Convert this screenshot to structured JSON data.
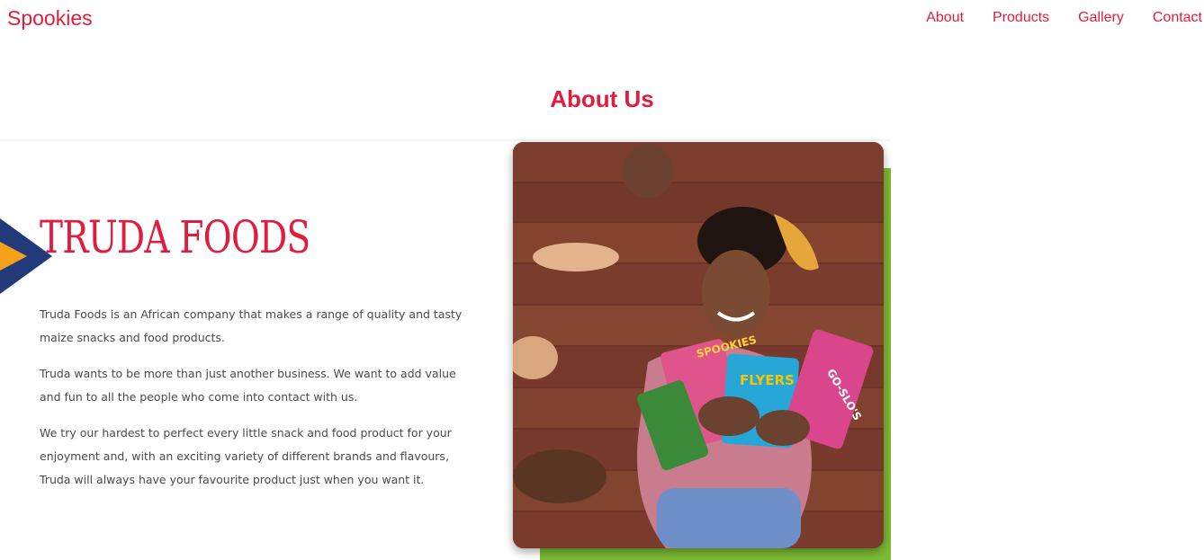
{
  "header": {
    "brand": "Spookies",
    "nav": [
      {
        "label": "About"
      },
      {
        "label": "Products"
      },
      {
        "label": "Gallery"
      },
      {
        "label": "Contact"
      }
    ]
  },
  "about": {
    "title": "About Us",
    "banner": {
      "heading": "TRUDA FOODS",
      "paragraphs": [
        "Truda Foods is an African company that makes a range of quality and tasty maize snacks and food products.",
        "Truda wants to be more than just another business. We want to add value and fun to all the people who come into contact with us.",
        "We try our hardest to perfect every little snack and food product for your enjoyment and, with an exciting variety of different brands and flavours, Truda will always have your favourite product just when you want it."
      ],
      "photo_packs": [
        "SPOOKIES",
        "FLYERS",
        "GO-SLO'S"
      ]
    }
  },
  "colors": {
    "brand_red": "#e11d3f",
    "accent_green": "#7cba34",
    "arrow_navy": "#233a7a",
    "arrow_orange": "#f5a11c",
    "wood": "#7a3b2c"
  }
}
